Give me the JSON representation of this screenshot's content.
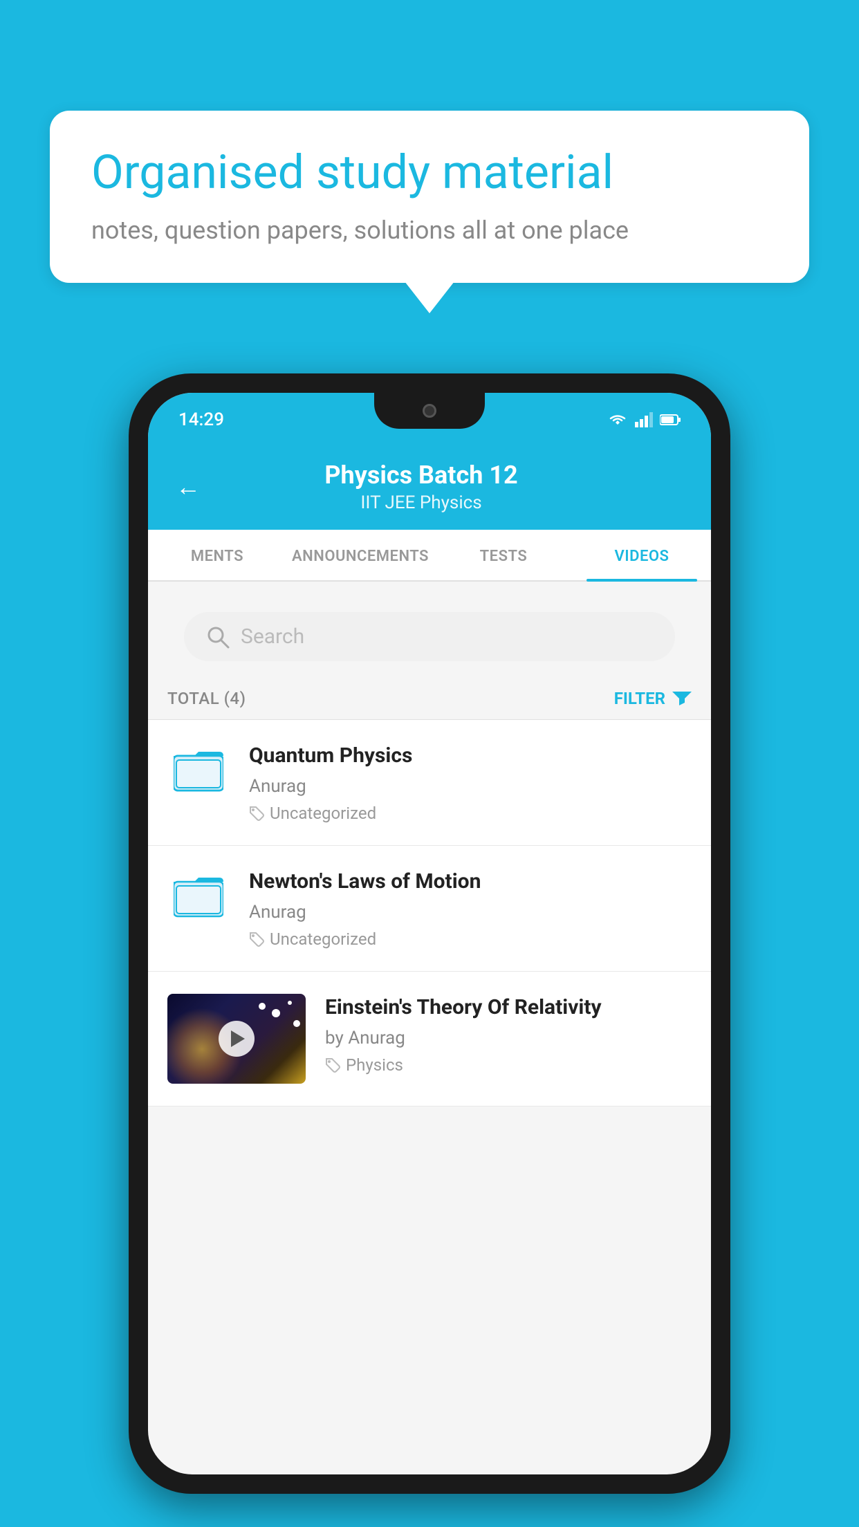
{
  "background_color": "#1bb8e0",
  "bubble": {
    "title": "Organised study material",
    "subtitle": "notes, question papers, solutions all at one place"
  },
  "phone": {
    "status_bar": {
      "time": "14:29",
      "icons": [
        "wifi",
        "signal",
        "battery"
      ]
    },
    "header": {
      "back_label": "←",
      "title": "Physics Batch 12",
      "subtitle": "IIT JEE   Physics"
    },
    "tabs": [
      {
        "label": "MENTS",
        "active": false
      },
      {
        "label": "ANNOUNCEMENTS",
        "active": false
      },
      {
        "label": "TESTS",
        "active": false
      },
      {
        "label": "VIDEOS",
        "active": true
      }
    ],
    "search": {
      "placeholder": "Search"
    },
    "filter": {
      "total_label": "TOTAL (4)",
      "filter_label": "FILTER"
    },
    "videos": [
      {
        "id": 1,
        "title": "Quantum Physics",
        "author": "Anurag",
        "tag": "Uncategorized",
        "type": "folder"
      },
      {
        "id": 2,
        "title": "Newton's Laws of Motion",
        "author": "Anurag",
        "tag": "Uncategorized",
        "type": "folder"
      },
      {
        "id": 3,
        "title": "Einstein's Theory Of Relativity",
        "author": "by Anurag",
        "tag": "Physics",
        "type": "video"
      }
    ]
  }
}
